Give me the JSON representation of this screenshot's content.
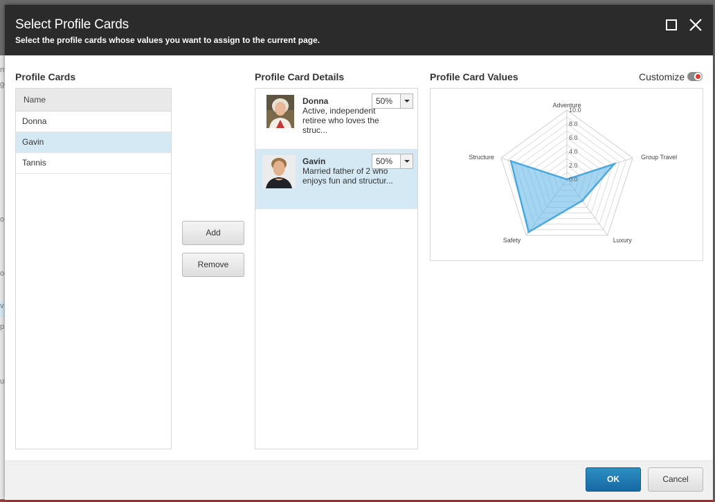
{
  "dialog": {
    "title": "Select Profile Cards",
    "subtitle": "Select the profile cards whose values you want to assign to the current page."
  },
  "profile_cards": {
    "heading": "Profile Cards",
    "column_header": "Name",
    "items": [
      {
        "name": "Donna",
        "selected": false
      },
      {
        "name": "Gavin",
        "selected": true
      },
      {
        "name": "Tannis",
        "selected": false
      }
    ]
  },
  "actions": {
    "add_label": "Add",
    "remove_label": "Remove"
  },
  "details": {
    "heading": "Profile Card Details",
    "items": [
      {
        "name": "Donna",
        "description": "Active, independent retiree who loves the struc...",
        "percentage": "50%"
      },
      {
        "name": "Gavin",
        "description": "Married father of 2 who enjoys fun and structur...",
        "percentage": "50%"
      }
    ]
  },
  "values": {
    "heading": "Profile Card Values",
    "customize_label": "Customize"
  },
  "footer": {
    "ok_label": "OK",
    "cancel_label": "Cancel"
  },
  "colors": {
    "header_bg": "#2b2b2b",
    "selection": "#d4e9f3",
    "primary": "#1f7ab4",
    "radar_fill": "#5bb4e5"
  },
  "chart_data": {
    "type": "radar",
    "axes": [
      "Adventure",
      "Group Travel",
      "Luxury",
      "Safety",
      "Structure"
    ],
    "scale_labels": [
      "0.0",
      "2.0",
      "4.0",
      "6.0",
      "8.0",
      "10.0"
    ],
    "range": [
      0,
      10
    ],
    "series": [
      {
        "values": [
          0,
          7.2,
          3.8,
          9.4,
          8.5
        ]
      }
    ],
    "grid": true
  }
}
